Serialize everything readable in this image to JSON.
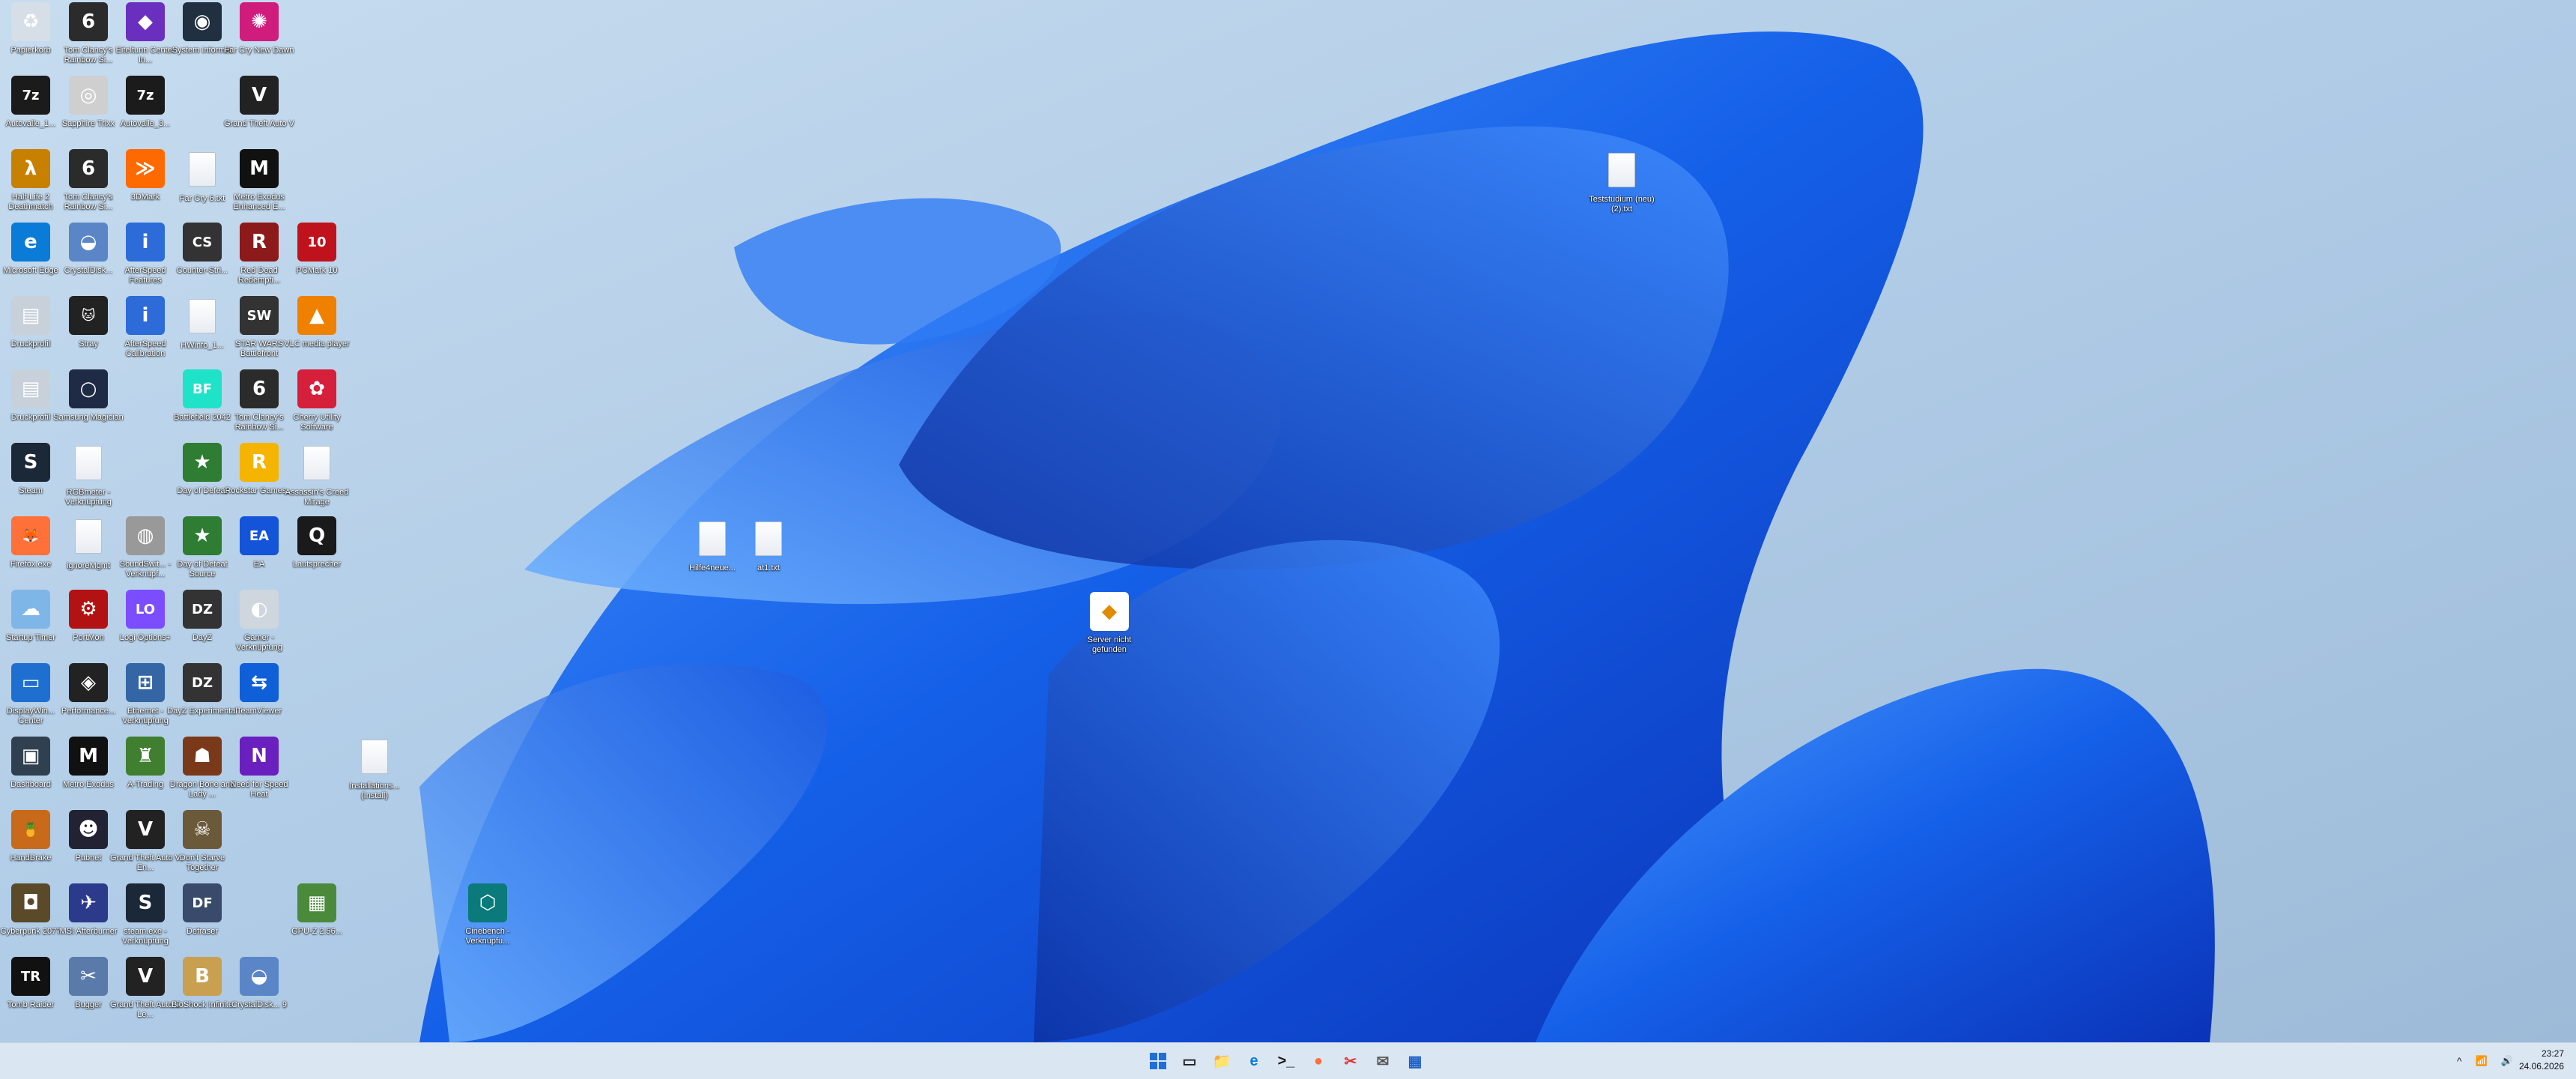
{
  "desktop": {
    "icons": [
      {
        "label": "Papierkorb",
        "glyph": "♻",
        "color": "#d6dee8"
      },
      {
        "label": "Tom Clancy's Rainbow Si...",
        "glyph": "6",
        "color": "#2b2b2b"
      },
      {
        "label": "Eiteltunn Center In...",
        "glyph": "◆",
        "color": "#6a2fbf"
      },
      {
        "label": "System Informer",
        "glyph": "◉",
        "color": "#203040"
      },
      {
        "label": "Far Cry New Dawn",
        "glyph": "✺",
        "color": "#d01c7c"
      },
      {
        "label": "Autovalle_1...",
        "glyph": "7z",
        "color": "#1b1b1b"
      },
      {
        "label": "Sapphire Trixx",
        "glyph": "◎",
        "color": "#cfcfcf"
      },
      {
        "label": "Autovalle_3...",
        "glyph": "7z",
        "color": "#1b1b1b"
      },
      {
        "label": "Grand Theft Auto V",
        "glyph": "V",
        "color": "#222"
      },
      {
        "label": "Half-Life 2 Deathmatch",
        "glyph": "λ",
        "color": "#c88000"
      },
      {
        "label": "Tom Clancy's Rainbow Si...",
        "glyph": "6",
        "color": "#2b2b2b"
      },
      {
        "label": "3DMark",
        "glyph": "≫",
        "color": "#ff6a00"
      },
      {
        "label": "Far Cry 6.txt",
        "glyph": "",
        "color": "doc"
      },
      {
        "label": "Metro Exodus Enhanced E...",
        "glyph": "M",
        "color": "#111"
      },
      {
        "label": "Microsoft Edge",
        "glyph": "e",
        "color": "#0a7bd6"
      },
      {
        "label": "CrystalDisk...",
        "glyph": "◒",
        "color": "#5a86c8"
      },
      {
        "label": "AfterSpeed Features",
        "glyph": "i",
        "color": "#2d6bd9"
      },
      {
        "label": "Counter-Stri...",
        "glyph": "CS",
        "color": "#333"
      },
      {
        "label": "Red Dead Redempti...",
        "glyph": "R",
        "color": "#8c1a1a"
      },
      {
        "label": "PCMark 10",
        "glyph": "10",
        "color": "#c0121c"
      },
      {
        "label": "Druckprofil",
        "glyph": "▤",
        "color": "#c8d0da"
      },
      {
        "label": "Stray",
        "glyph": "🐱",
        "color": "#222"
      },
      {
        "label": "AfterSpeed Calibration",
        "glyph": "i",
        "color": "#2d6bd9"
      },
      {
        "label": "HWinfo_1...",
        "glyph": "",
        "color": "doc"
      },
      {
        "label": "STAR WARS Battlefront",
        "glyph": "SW",
        "color": "#333"
      },
      {
        "label": "VLC media player",
        "glyph": "▲",
        "color": "#f08000"
      },
      {
        "label": "Druckprofil",
        "glyph": "▤",
        "color": "#c8d0da"
      },
      {
        "label": "Samsung Magician",
        "glyph": "○",
        "color": "#1f2a44"
      },
      {
        "label": "Battlefield 2042",
        "glyph": "BF",
        "color": "#1fe3c8"
      },
      {
        "label": "Tom Clancy's Rainbow Si...",
        "glyph": "6",
        "color": "#2b2b2b"
      },
      {
        "label": "Cherry Utility Software",
        "glyph": "✿",
        "color": "#d61f3a"
      },
      {
        "label": "Steam",
        "glyph": "S",
        "color": "#1b2838"
      },
      {
        "label": "RGBmeter - Verknüpfung",
        "glyph": "",
        "color": "doc"
      },
      {
        "label": "Day of Defeat",
        "glyph": "★",
        "color": "#2e7d32"
      },
      {
        "label": "Rockstar Games...",
        "glyph": "R",
        "color": "#f5b400"
      },
      {
        "label": "Assassin's Creed Mirage",
        "glyph": "",
        "color": "doc"
      },
      {
        "label": "Firefox.exe",
        "glyph": "🦊",
        "color": "#ff7139"
      },
      {
        "label": "ignoreMgmt",
        "glyph": "",
        "color": "doc"
      },
      {
        "label": "SoundSwit... - Verknüpf...",
        "glyph": "◍",
        "color": "#999"
      },
      {
        "label": "Day of Defeat Source",
        "glyph": "★",
        "color": "#2e7d32"
      },
      {
        "label": "EA",
        "glyph": "EA",
        "color": "#1454d9"
      },
      {
        "label": "Lautsprecher",
        "glyph": "Q",
        "color": "#1a1a1a"
      },
      {
        "label": "Startup Timer",
        "glyph": "☁",
        "color": "#7fb6e8"
      },
      {
        "label": "PortMon",
        "glyph": "⚙",
        "color": "#b31212"
      },
      {
        "label": "Logi Options+",
        "glyph": "LO",
        "color": "#7c4dff"
      },
      {
        "label": "DayZ",
        "glyph": "DZ",
        "color": "#333"
      },
      {
        "label": "Gamer - Verknüpfung",
        "glyph": "◐",
        "color": "#cfd6de"
      },
      {
        "label": "DisplayWin... Center",
        "glyph": "▭",
        "color": "#1f6fd1"
      },
      {
        "label": "Performance...",
        "glyph": "◈",
        "color": "#222"
      },
      {
        "label": "Ethernet - Verknüpfung",
        "glyph": "⊞",
        "color": "#3465a4"
      },
      {
        "label": "DayZ Experimental",
        "glyph": "DZ",
        "color": "#333"
      },
      {
        "label": "TeamViewer",
        "glyph": "⇆",
        "color": "#0e5fd8"
      },
      {
        "label": "Dashboard",
        "glyph": "▣",
        "color": "#304050"
      },
      {
        "label": "Metro Exodus",
        "glyph": "M",
        "color": "#111"
      },
      {
        "label": "A-Trading",
        "glyph": "♜",
        "color": "#3f7f2f"
      },
      {
        "label": "Dragon Bone and Lady ...",
        "glyph": "☗",
        "color": "#7a3a1a"
      },
      {
        "label": "Need for Speed Heat",
        "glyph": "N",
        "color": "#6a1fbf"
      },
      {
        "label": "Installations... (Install)",
        "glyph": "",
        "color": "doc"
      },
      {
        "label": "HandBrake",
        "glyph": "🍍",
        "color": "#c86a1a"
      },
      {
        "label": "Pubnet",
        "glyph": "☻",
        "color": "#223"
      },
      {
        "label": "Grand Theft Auto V En...",
        "glyph": "V",
        "color": "#222"
      },
      {
        "label": "Don't Starve Together",
        "glyph": "☠",
        "color": "#6b5a3a"
      },
      {
        "label": "Cyberpunk 2077",
        "glyph": "◘",
        "color": "#5a4a2a"
      },
      {
        "label": "MSI Afterburner",
        "glyph": "✈",
        "color": "#2b3a8a"
      },
      {
        "label": "steam.exe - Verknüpfung",
        "glyph": "S",
        "color": "#1b2838"
      },
      {
        "label": "Defraser",
        "glyph": "DF",
        "color": "#3a4a6a"
      },
      {
        "label": "GPU-Z 2.56...",
        "glyph": "▦",
        "color": "#4a8a3a"
      },
      {
        "label": "Cinebench - Verknüpfu...",
        "glyph": "⬡",
        "color": "#0a7a7a"
      },
      {
        "label": "Tomb Raider",
        "glyph": "TR",
        "color": "#111"
      },
      {
        "label": "Bugger",
        "glyph": "✂",
        "color": "#5a7aaa"
      },
      {
        "label": "Grand Theft Auto V Le...",
        "glyph": "V",
        "color": "#222"
      },
      {
        "label": "BioShock Infinite",
        "glyph": "B",
        "color": "#c8a050"
      },
      {
        "label": "CrystalDisk... 9",
        "glyph": "◒",
        "color": "#5a86c8"
      },
      {
        "label": "Teststudium (neu) (2).txt",
        "glyph": "",
        "color": "doc"
      },
      {
        "label": "Hilfe4neue...",
        "glyph": "",
        "color": "doc"
      },
      {
        "label": "at1.txt",
        "glyph": "",
        "color": "doc"
      },
      {
        "label": "Server nicht gefunden",
        "glyph": "◆",
        "color": "#ffffff"
      }
    ]
  },
  "taskbar": {
    "start_label": "Start",
    "items": [
      {
        "name": "taskview-icon",
        "glyph": "▭",
        "color": "#222"
      },
      {
        "name": "explorer-icon",
        "glyph": "📁",
        "color": "#e8b000"
      },
      {
        "name": "edge-icon",
        "glyph": "e",
        "color": "#0a7bd6"
      },
      {
        "name": "terminal-icon",
        "glyph": ">_",
        "color": "#1a1a1a"
      },
      {
        "name": "firefox-icon",
        "glyph": "●",
        "color": "#ff7139"
      },
      {
        "name": "snipping-icon",
        "glyph": "✂",
        "color": "#d33"
      },
      {
        "name": "mail-icon",
        "glyph": "✉",
        "color": "#555"
      },
      {
        "name": "calculator-icon",
        "glyph": "▦",
        "color": "#1f5fc8"
      }
    ],
    "tray": {
      "chevron": "^",
      "wifi": "📶",
      "volume": "🔊"
    },
    "clock": {
      "time": "23:27",
      "date": "24.06.2026"
    }
  },
  "colors": {
    "taskbar_bg": "#dbe6f3",
    "wallpaper_bg": "#b9d3ea",
    "petal": "#1f6fe8"
  }
}
